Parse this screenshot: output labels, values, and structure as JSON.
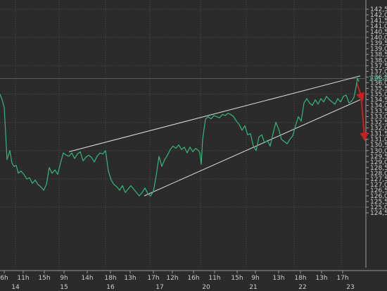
{
  "chart_data": {
    "type": "line",
    "title": "",
    "xlabel": "",
    "ylabel": "",
    "ylim": [
      124.5,
      142.8
    ],
    "grid": true,
    "yticks": [
      "142,5",
      "142,0",
      "141,5",
      "141,0",
      "140,5",
      "140,0",
      "139,5",
      "139,0",
      "138,5",
      "138,0",
      "137,5",
      "137,0",
      "136,5",
      "136,0",
      "135,5",
      "135,0",
      "134,5",
      "134,0",
      "133,5",
      "133,0",
      "132,5",
      "132,0",
      "131,5",
      "131,0",
      "130,5",
      "130,0",
      "129,5",
      "129,0",
      "128,5",
      "128,0",
      "127,5",
      "127,0",
      "126,5",
      "126,0",
      "125,5",
      "125,0",
      "124,5"
    ],
    "xticks_hours": [
      "6h",
      "11h",
      "15h",
      "9h",
      "14h",
      "18h",
      "13h",
      "17h",
      "12h",
      "16h",
      "11h",
      "15h",
      "9h",
      "13h",
      "18h",
      "13h",
      "17h"
    ],
    "xticks_days": [
      "14",
      "15",
      "16",
      "17",
      "20",
      "21",
      "22",
      "23"
    ],
    "last_value_label": "136,37",
    "series": [
      {
        "color": "#36b67e",
        "t": [
          0,
          3,
          6,
          10,
          14,
          17,
          20,
          23,
          26,
          30,
          34,
          38,
          42,
          46,
          50,
          54,
          58,
          62,
          66,
          70,
          74,
          78,
          82,
          86,
          90,
          94,
          98,
          102,
          106,
          110,
          114,
          118,
          122,
          126,
          130,
          134,
          138,
          142,
          146,
          150,
          154,
          158,
          162,
          166,
          170,
          174,
          178,
          182,
          186,
          190,
          194,
          198,
          202,
          206,
          210,
          214,
          218,
          222,
          226,
          230,
          234,
          238,
          242,
          246,
          250,
          254,
          258,
          262,
          266,
          270,
          274,
          278,
          282,
          284,
          286,
          288,
          292,
          296,
          300,
          304,
          308,
          312,
          316,
          320,
          324,
          328,
          332,
          336,
          340,
          344,
          348,
          352,
          356,
          360,
          364,
          368,
          372,
          376,
          380,
          384,
          388,
          392,
          396,
          400,
          404,
          408,
          412,
          416,
          420,
          424,
          428,
          432,
          436,
          440,
          444,
          448,
          452,
          456,
          460,
          464,
          468,
          472,
          476,
          480,
          484,
          488,
          492,
          496,
          500,
          503,
          506,
          508,
          510
        ],
        "y": [
          135.0,
          134.5,
          133.8,
          129.2,
          130.0,
          128.9,
          128.6,
          128.7,
          128.0,
          128.2,
          127.9,
          127.5,
          127.6,
          127.1,
          127.4,
          127.0,
          126.8,
          126.5,
          127.0,
          128.5,
          128.0,
          128.3,
          127.9,
          128.9,
          129.8,
          129.6,
          129.5,
          129.8,
          129.3,
          129.7,
          129.9,
          129.1,
          129.4,
          129.6,
          129.4,
          129.0,
          129.5,
          129.8,
          129.7,
          130.0,
          128.2,
          127.4,
          127.0,
          126.8,
          126.5,
          126.9,
          126.3,
          126.6,
          126.9,
          126.6,
          126.3,
          126.0,
          126.3,
          126.7,
          126.2,
          126.0,
          126.4,
          127.8,
          129.5,
          128.6,
          129.2,
          129.6,
          130.1,
          130.4,
          130.2,
          130.5,
          130.1,
          130.3,
          129.8,
          130.3,
          129.9,
          130.2,
          130.0,
          129.8,
          128.8,
          131.0,
          132.8,
          133.0,
          132.8,
          133.1,
          133.0,
          132.9,
          133.2,
          133.1,
          133.3,
          133.2,
          133.0,
          132.6,
          132.3,
          131.8,
          132.2,
          131.4,
          131.5,
          130.4,
          130.0,
          131.2,
          131.4,
          130.7,
          130.9,
          130.4,
          131.5,
          132.5,
          131.9,
          131.0,
          130.8,
          130.6,
          131.0,
          131.3,
          132.2,
          133.0,
          132.6,
          134.2,
          134.6,
          134.2,
          134.0,
          134.5,
          134.1,
          134.6,
          134.3,
          134.8,
          134.5,
          134.3,
          134.1,
          134.6,
          134.3,
          134.8,
          134.9,
          134.2,
          134.4,
          134.7,
          135.6,
          136.4,
          136.1
        ]
      }
    ],
    "annotations": [
      {
        "type": "trendline",
        "t": [
          98,
          512
        ],
        "y": [
          129.9,
          136.6
        ],
        "color": "#dcdcdc"
      },
      {
        "type": "trendline",
        "t": [
          205,
          512
        ],
        "y": [
          126.0,
          134.5
        ],
        "color": "#dcdcdc"
      },
      {
        "type": "arrow",
        "t": [
          507,
          514
        ],
        "y": [
          136.0,
          134.7
        ],
        "color": "#cc1f1f"
      },
      {
        "type": "arrow",
        "t": [
          513,
          518
        ],
        "y": [
          134.9,
          131.2
        ],
        "color": "#cc1f1f"
      }
    ],
    "reference_level": 136.37
  }
}
